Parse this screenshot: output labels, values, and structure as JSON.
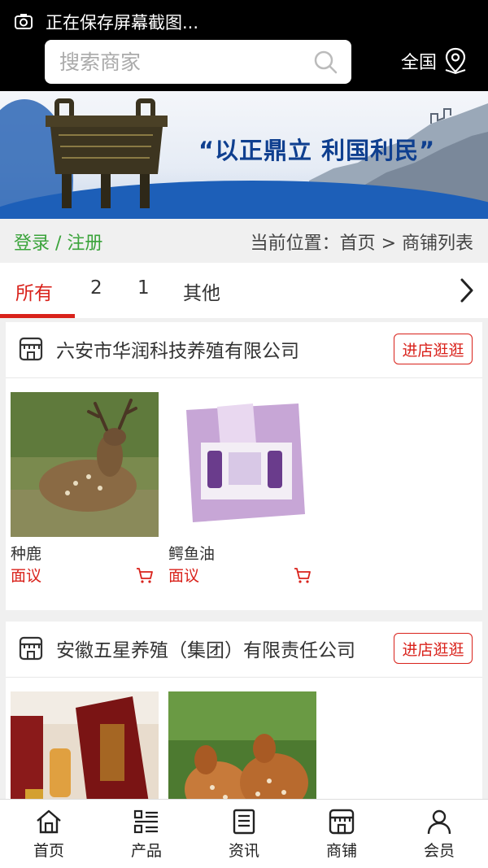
{
  "status": {
    "text": "正在保存屏幕截图..."
  },
  "header": {
    "search_placeholder": "搜索商家",
    "region_label": "全国"
  },
  "banner": {
    "slogan": "“以正鼎立  利国利民”"
  },
  "breadcrumb": {
    "login_label": "登录 / 注册",
    "location_label": "当前位置：首页 > 商铺列表"
  },
  "tabs": [
    {
      "label": "所有",
      "active": true
    },
    {
      "label": "2"
    },
    {
      "label": "1"
    },
    {
      "label": "其他"
    }
  ],
  "shops": [
    {
      "name": "六安市华润科技养殖有限公司",
      "visit_label": "进店逛逛",
      "products": [
        {
          "name": "种鹿",
          "price": "面议"
        },
        {
          "name": "鳄鱼油",
          "price": "面议"
        }
      ]
    },
    {
      "name": "安徽五星养殖（集团）有限责任公司",
      "visit_label": "进店逛逛",
      "products": [
        {
          "name": "",
          "price": ""
        },
        {
          "name": "",
          "price": ""
        }
      ]
    }
  ],
  "bottom_nav": [
    {
      "label": "首页",
      "icon": "home-icon"
    },
    {
      "label": "产品",
      "icon": "list-icon"
    },
    {
      "label": "资讯",
      "icon": "news-icon"
    },
    {
      "label": "商铺",
      "icon": "store-icon"
    },
    {
      "label": "会员",
      "icon": "user-icon"
    }
  ],
  "colors": {
    "accent": "#d9221b",
    "login_green": "#3aa33a",
    "header_bg": "#000000"
  }
}
